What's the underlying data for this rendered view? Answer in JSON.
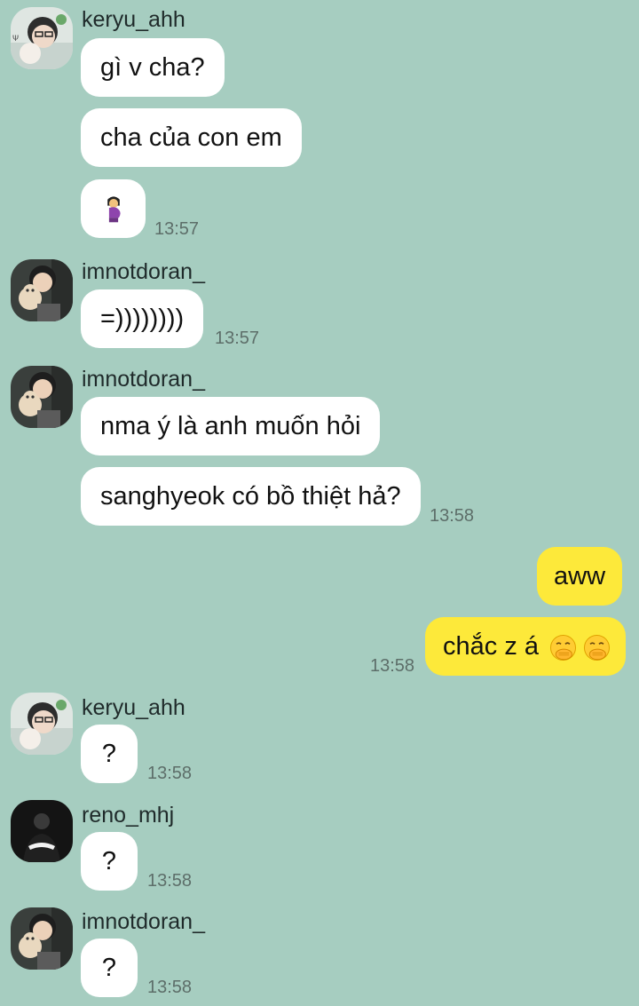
{
  "messages": [
    {
      "sender": "keryu_ahh",
      "bubbles": [
        "gì v cha?",
        "cha của con em"
      ],
      "sticker_icon": "pregnant-person-emoji",
      "time": "13:57"
    },
    {
      "sender": "imnotdoran_",
      "bubbles": [
        "=))))))))"
      ],
      "time": "13:57"
    },
    {
      "sender": "imnotdoran_",
      "bubbles": [
        "nma ý là anh muốn hỏi",
        "sanghyeok có bồ thiệt hả?"
      ],
      "time": "13:58"
    },
    {
      "sender": "me",
      "bubbles": [
        "aww",
        "chắc z á"
      ],
      "emoji_icons": [
        "face-with-hand-over-mouth-emoji",
        "face-with-hand-over-mouth-emoji"
      ],
      "time": "13:58"
    },
    {
      "sender": "keryu_ahh",
      "bubbles": [
        "?"
      ],
      "time": "13:58"
    },
    {
      "sender": "reno_mhj",
      "bubbles": [
        "?"
      ],
      "time": "13:58"
    },
    {
      "sender": "imnotdoran_",
      "bubbles": [
        "?"
      ],
      "time": "13:58"
    }
  ],
  "colors": {
    "background": "#a6cdc0",
    "incoming_bubble": "#ffffff",
    "outgoing_bubble": "#fde93a",
    "timestamp": "#5d6e69"
  }
}
